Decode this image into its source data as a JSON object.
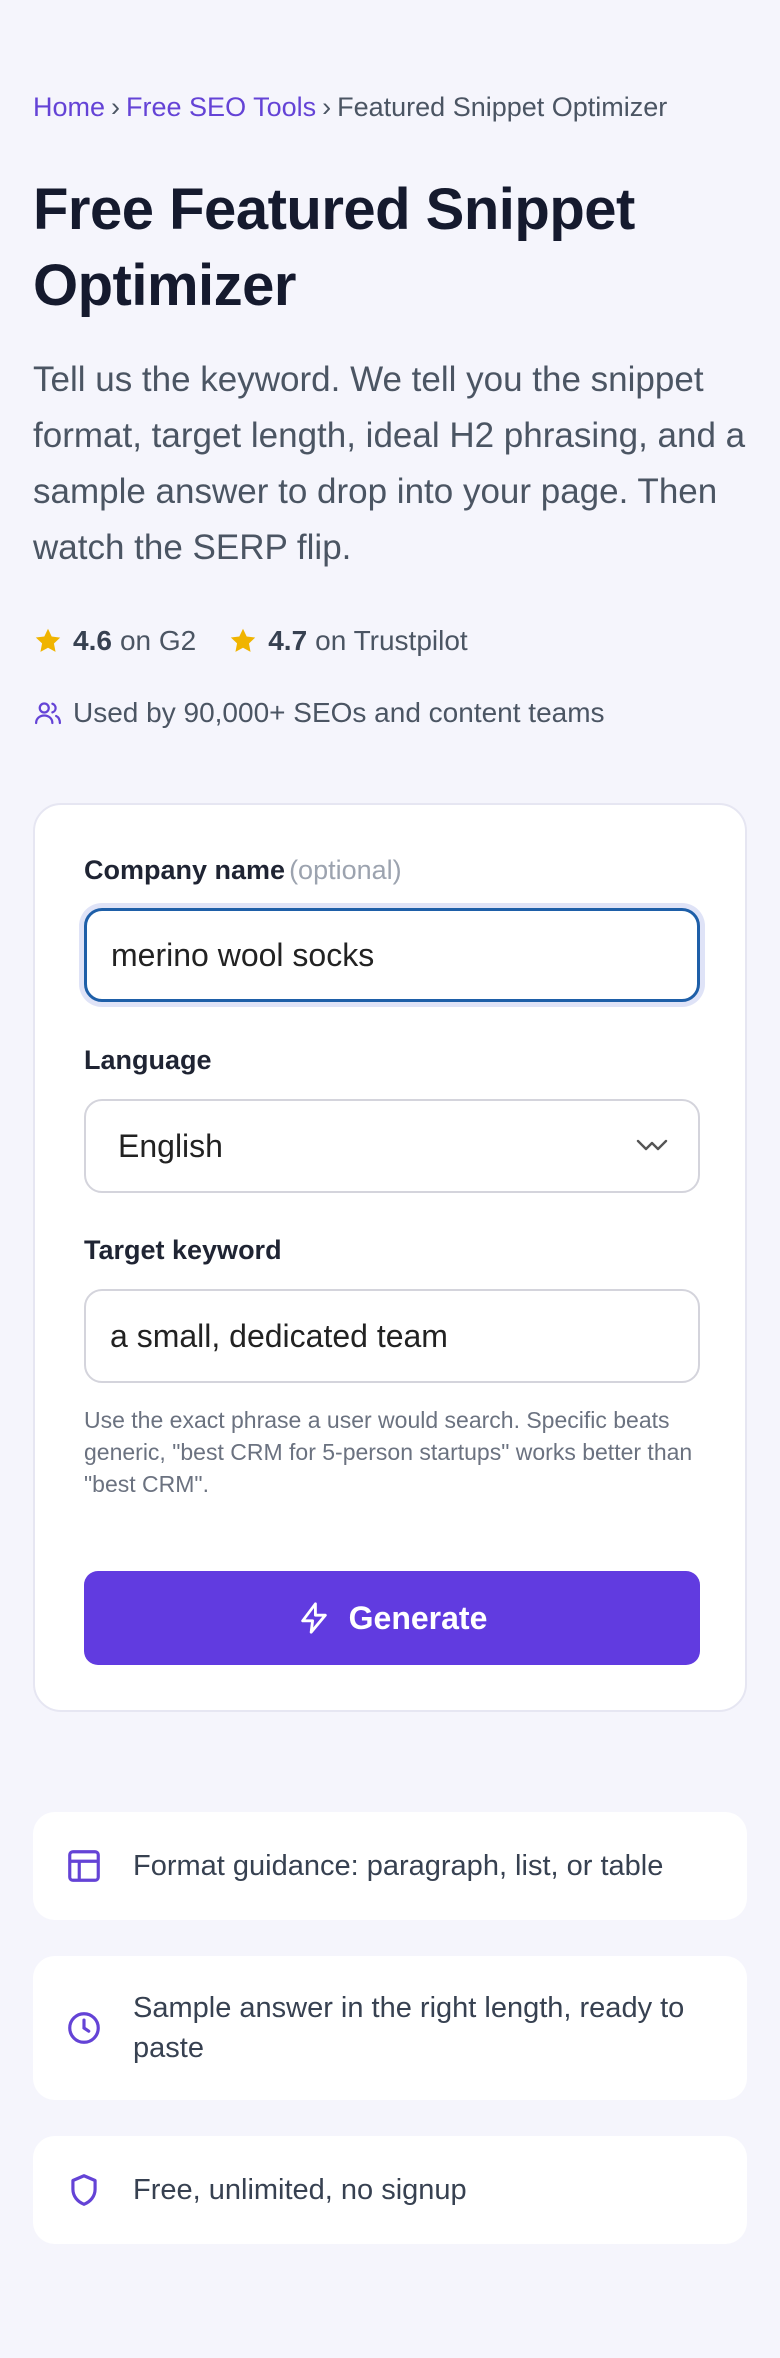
{
  "breadcrumb": {
    "home": "Home",
    "separator": "›",
    "tools": "Free SEO Tools",
    "current": "Featured Snippet Optimizer"
  },
  "title": "Free Featured Snippet Optimizer",
  "lead": "Tell us the keyword. We tell you the snippet format, target length, ideal H2 phrasing, and a sample answer to drop into your page. Then watch the SERP flip.",
  "ratings": [
    {
      "score": "4.6",
      "source": "on G2",
      "icon": "star-icon"
    },
    {
      "score": "4.7",
      "source": "on Trustpilot",
      "icon": "star-icon"
    }
  ],
  "users_text": "Used by 90,000+ SEOs and content teams",
  "form": {
    "company_label": "Company name",
    "company_optional": "(optional)",
    "company_value": "merino wool socks",
    "language_label": "Language",
    "language_value": "English",
    "keyword_label": "Target keyword",
    "keyword_value": "a small, dedicated team",
    "keyword_help": "Use the exact phrase a user would search. Specific beats generic, \"best CRM for 5-person startups\" works better than \"best CRM\".",
    "submit_label": "Generate"
  },
  "features": [
    {
      "icon": "layout-icon",
      "text": "Format guidance: paragraph, list, or table"
    },
    {
      "icon": "clock-icon",
      "text": "Sample answer in the right length, ready to paste"
    },
    {
      "icon": "shield-icon",
      "text": "Free, unlimited, no signup"
    }
  ],
  "colors": {
    "accent": "#613be0",
    "link": "#6443d6",
    "star": "#f0b400",
    "focus_border": "#1e5fa8",
    "background": "#f5f5fc"
  }
}
